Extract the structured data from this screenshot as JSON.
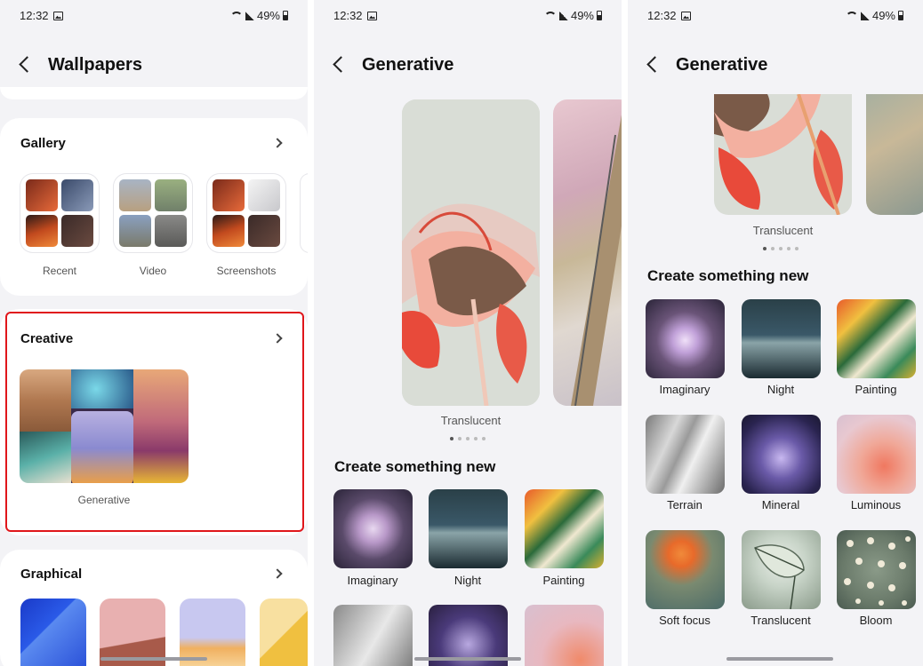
{
  "status": {
    "time": "12:32",
    "battery": "49%"
  },
  "screen1": {
    "title": "Wallpapers",
    "gallery": {
      "title": "Gallery",
      "items": [
        {
          "label": "Recent"
        },
        {
          "label": "Video"
        },
        {
          "label": "Screenshots"
        }
      ]
    },
    "creative": {
      "title": "Creative",
      "item_label": "Generative"
    },
    "graphical": {
      "title": "Graphical"
    }
  },
  "screen2": {
    "title": "Generative",
    "preview_label": "Translucent",
    "page_count": 5,
    "active_page": 1,
    "section_title": "Create something new",
    "tiles": [
      {
        "label": "Imaginary"
      },
      {
        "label": "Night"
      },
      {
        "label": "Painting"
      }
    ]
  },
  "screen3": {
    "title": "Generative",
    "preview_label": "Translucent",
    "section_title": "Create something new",
    "tiles": [
      {
        "label": "Imaginary",
        "icon": "crystal-ball-image"
      },
      {
        "label": "Night",
        "icon": "mountains-night-image"
      },
      {
        "label": "Painting",
        "icon": "leaves-painting-image"
      },
      {
        "label": "Terrain",
        "icon": "terrain-image"
      },
      {
        "label": "Mineral",
        "icon": "mineral-image"
      },
      {
        "label": "Luminous",
        "icon": "flower-image"
      },
      {
        "label": "Soft focus",
        "icon": "poppy-image"
      },
      {
        "label": "Translucent",
        "icon": "leaf-image"
      },
      {
        "label": "Bloom",
        "icon": "bloom-image"
      }
    ]
  },
  "colors": {
    "highlight": "#e0161b",
    "background": "#f3f3f6"
  }
}
